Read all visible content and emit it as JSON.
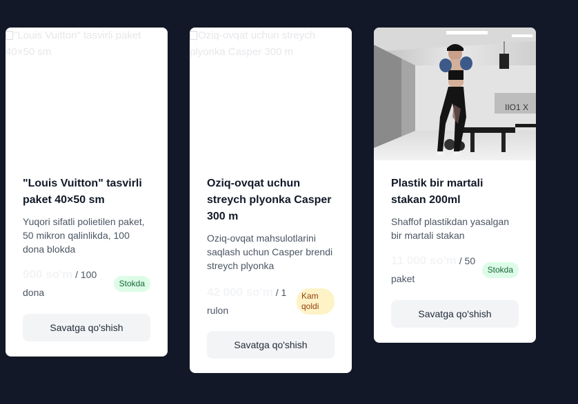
{
  "products": [
    {
      "image_alt": "\"Louis Vuitton\" tasvirli paket 40×50 sm",
      "title": "\"Louis Vuitton\" tasvirli paket 40×50 sm",
      "description": "Yuqori sifatli polietilen paket, 50 mikron qalinlikda, 100 dona blokda",
      "price": "900 so'm",
      "unit": "/ 100 dona",
      "stock_badge": "Stokda",
      "cart_button": "Savatga qo'shish"
    },
    {
      "image_alt": "Oziq-ovqat uchun streych plyonka Casper 300 m",
      "title": "Oziq-ovqat uchun streych plyonka Casper 300 m",
      "description": "Oziq-ovqat mahsulotlarini saqlash uchun Casper brendi streych plyonka",
      "price": "42 000 so'm",
      "unit": "/ 1 rulon",
      "stock_badge": "Kam qoldi",
      "cart_button": "Savatga qo'shish"
    },
    {
      "title": "Plastik bir martali stakan 200ml",
      "description": "Shaffof plastikdan yasalgan bir martali stakan",
      "price": "11 000 so'm",
      "unit": "/ 50 paket",
      "stock_badge": "Stokda",
      "cart_button": "Savatga qo'shish"
    }
  ],
  "colors": {
    "background": "#121827",
    "card": "#ffffff",
    "badge_in_stock_bg": "#dcfce7",
    "badge_low_stock_bg": "#fef3c7"
  }
}
